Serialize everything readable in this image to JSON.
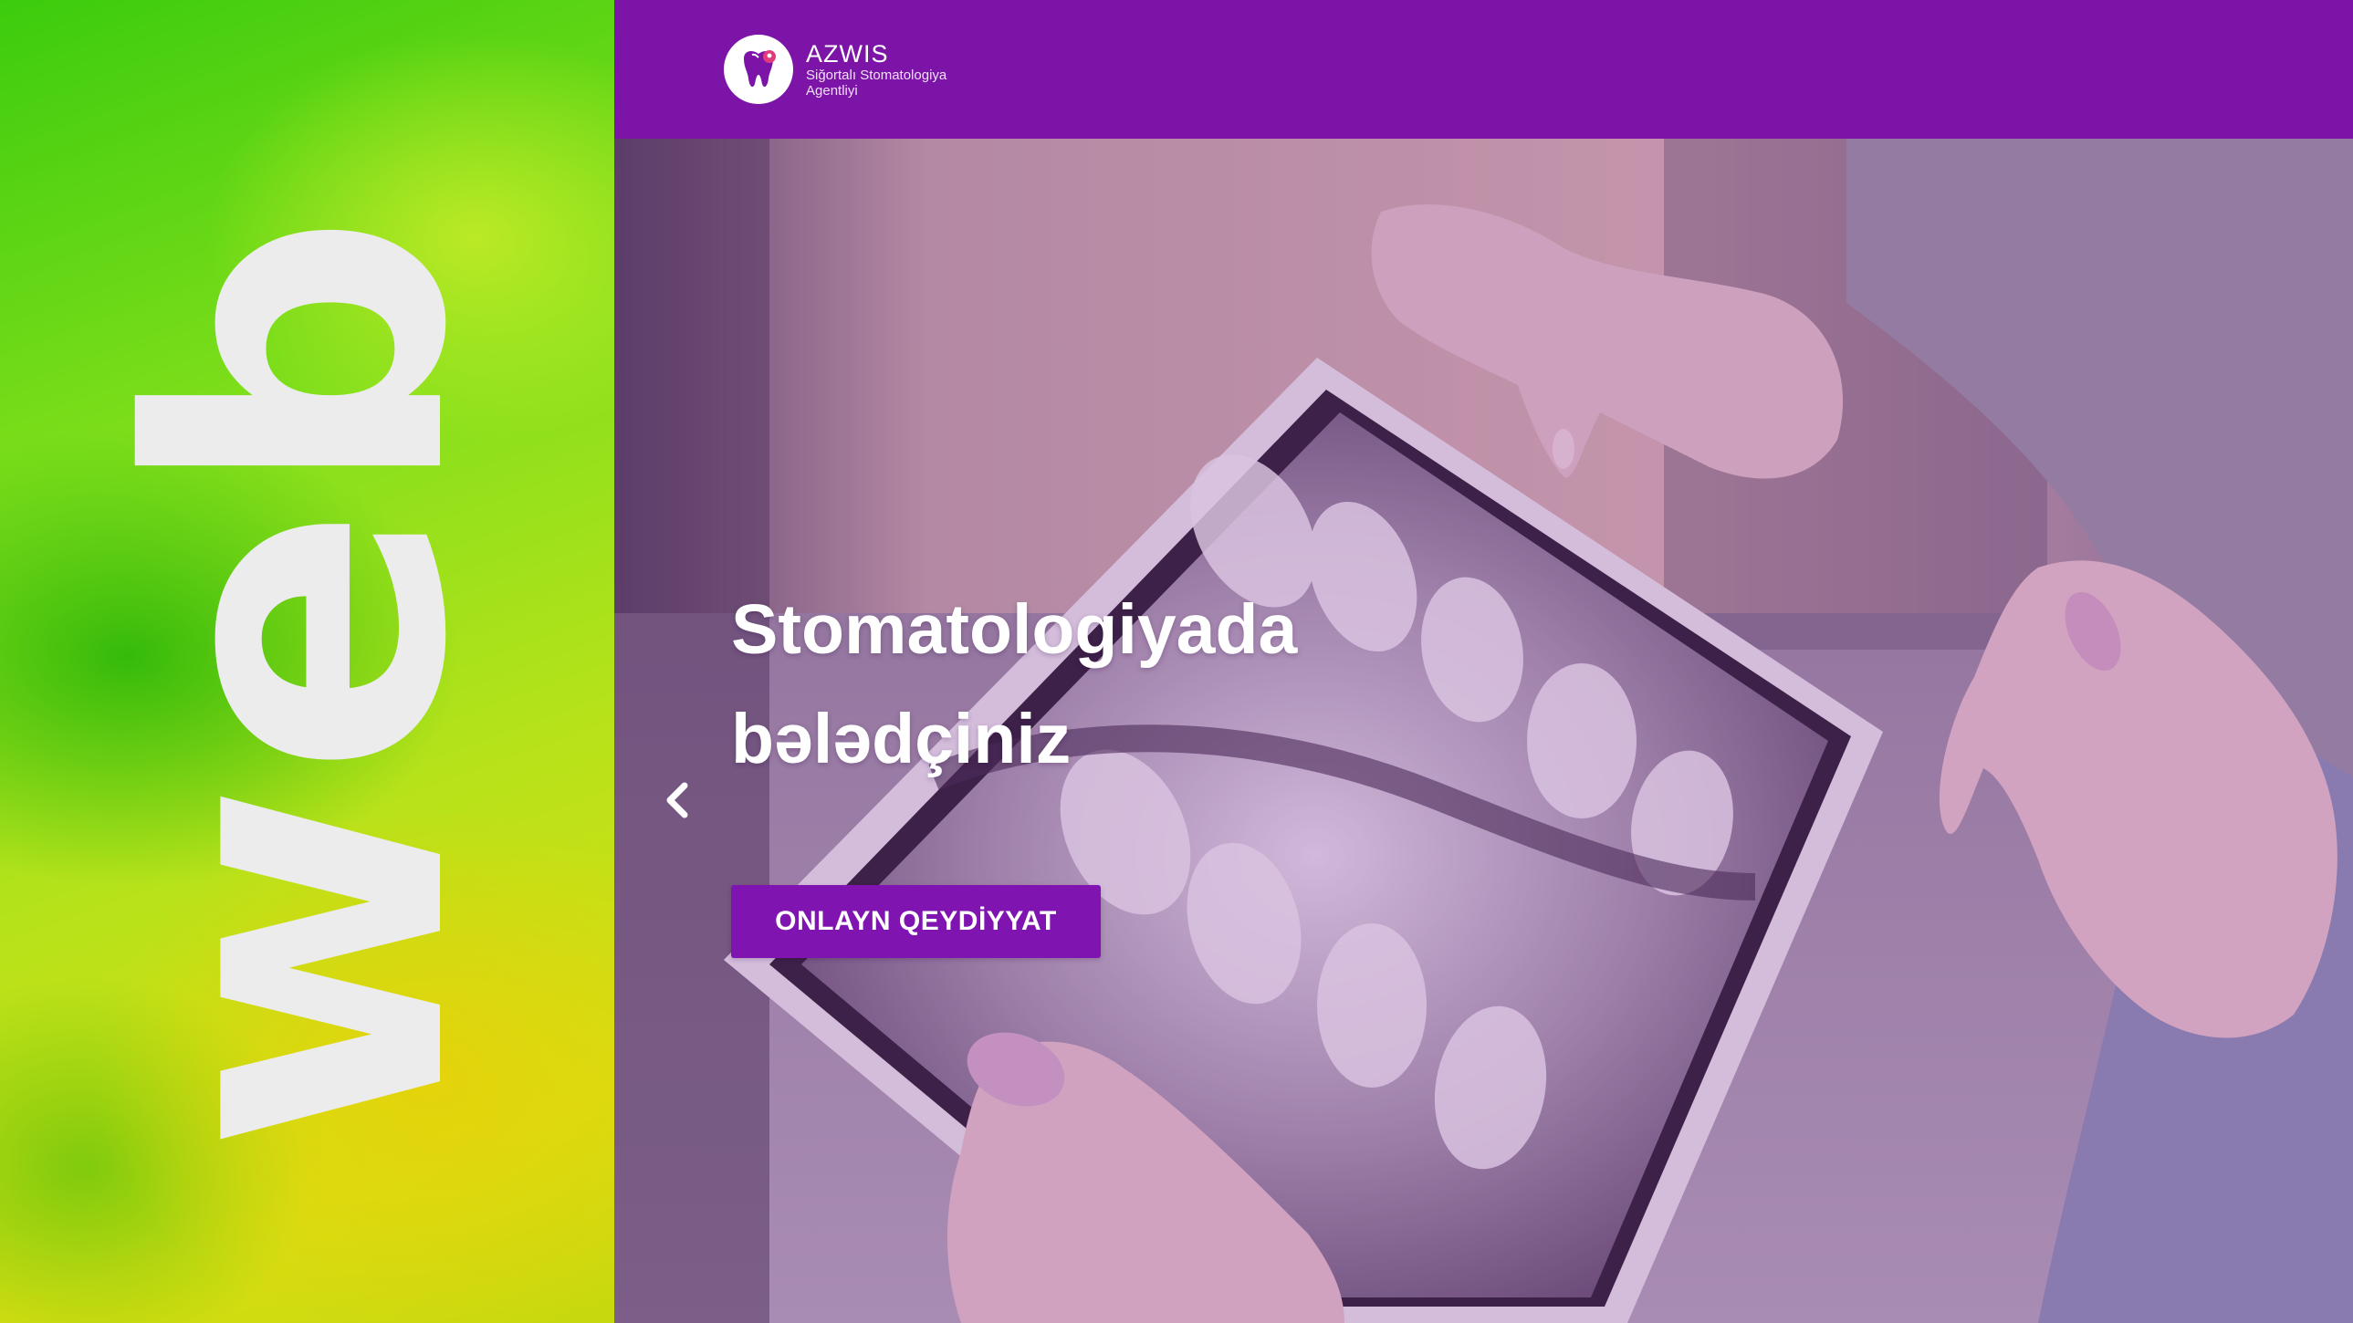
{
  "banner": {
    "word": "web"
  },
  "header": {
    "logo": {
      "name": "AZWIS",
      "subtitle_line1": "Siğortalı Stomatologiya",
      "subtitle_line2": "Agentliyi"
    }
  },
  "hero": {
    "title_line1": "Stomatologiyada",
    "title_line2": "bələdçiniz",
    "cta_label": "ONLAYN QEYDİYYAT",
    "prev_icon": "chevron-left-icon"
  },
  "colors": {
    "brand_purple": "#7d14a8",
    "button_purple": "#7f14b0",
    "panel_green": "#5ed414",
    "panel_yellow": "#d8de12",
    "text_white": "#ffffff"
  }
}
